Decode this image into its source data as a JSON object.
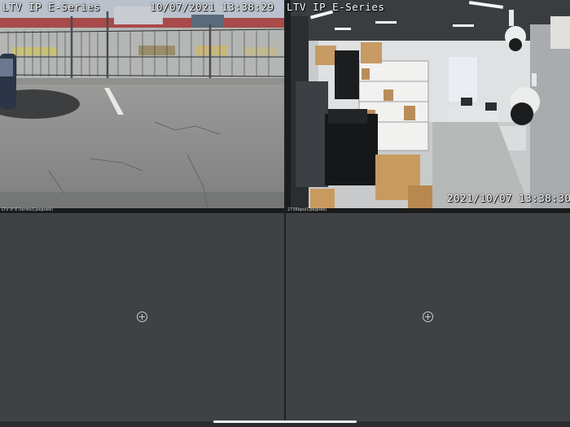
{
  "cameras": [
    {
      "osd_title": "LTV IP E-Series",
      "osd_timestamp": "10/07/2021 13:38:29",
      "status": "LTV IP E-Series(Среднее)"
    },
    {
      "osd_title": "LTV IP E-Series",
      "osd_timestamp": "2021/10/07 13:38:30",
      "status": "273Kbps(Среднее)"
    }
  ],
  "empty_slot_icon": "add-circle-icon",
  "colors": {
    "background": "#2a2c2e",
    "empty_tile": "#3f4245",
    "osd_text": "#ffffff"
  }
}
